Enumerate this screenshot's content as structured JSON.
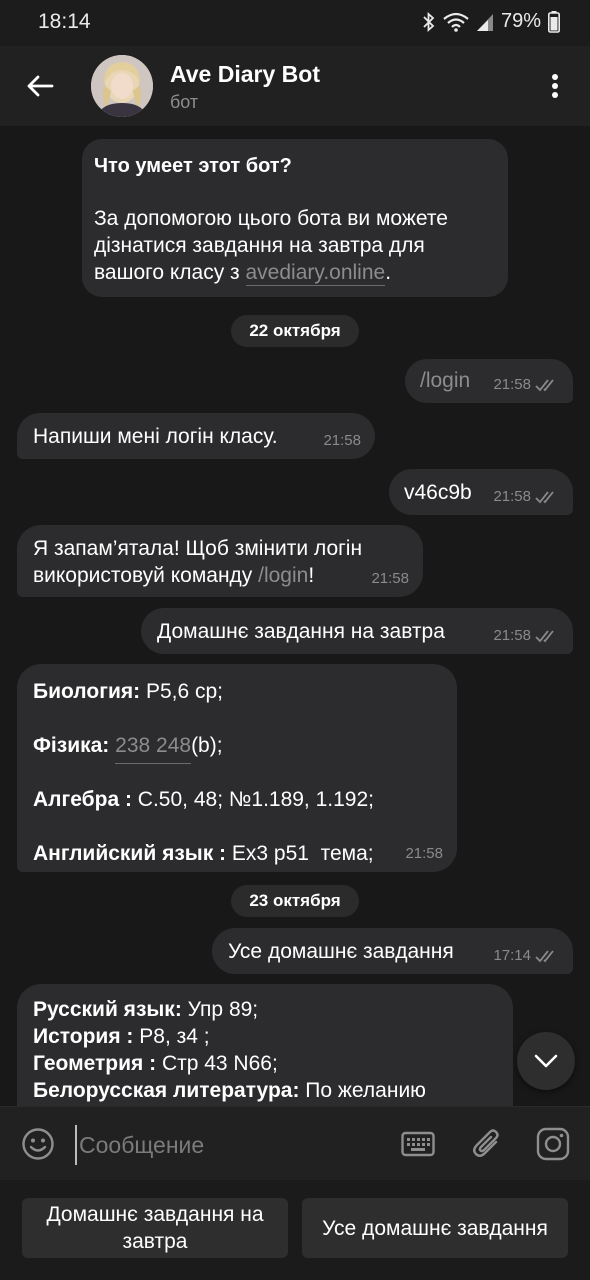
{
  "status_bar": {
    "time": "18:14",
    "battery": "79%",
    "icons": [
      "bluetooth-icon",
      "wifi-icon",
      "signal-icon",
      "battery-icon"
    ]
  },
  "header": {
    "title": "Ave Diary Bot",
    "subtitle": "бот",
    "icons": [
      "back-arrow-icon",
      "more-vertical-icon"
    ]
  },
  "intro_card": {
    "heading": "Что умеет этот бот?",
    "text_before": "За допомогою цього бота ви можете дізнатися завдання на завтра для вашого класу з ",
    "link": "avediary.online",
    "text_after": "."
  },
  "dates": [
    "22 октября",
    "23 октября"
  ],
  "messages": [
    {
      "dir": "out",
      "text": "/login",
      "time": "21:58"
    },
    {
      "dir": "in",
      "text": "Напиши мені логін класу.",
      "time": "21:58"
    },
    {
      "dir": "out",
      "text": "v46c9b",
      "time": "21:58"
    },
    {
      "dir": "in",
      "text_before": "Я запам’ятала! Щоб змінити логін використовуй команду ",
      "command": "/login",
      "text_after": "!",
      "time": "21:58"
    },
    {
      "dir": "out",
      "text": "Домашнє завдання на завтра",
      "time": "21:58"
    },
    {
      "dir": "in",
      "time": "21:58",
      "lines": [
        {
          "label": "Биология:",
          "value": " P5,6 cp;"
        },
        {
          "label": "Фізика:",
          "value_link": "238 248",
          "value": "(b);"
        },
        {
          "label": "Алгебра :",
          "value": " С.50, 48; №1.189, 1.192;"
        },
        {
          "label": "Английский язык :",
          "value": " Ex3 p51  тема;"
        }
      ]
    },
    {
      "dir": "out",
      "text": "Усе домашнє завдання",
      "time": "17:14"
    },
    {
      "dir": "in",
      "lines": [
        {
          "label": "Русский язык:",
          "value": " Упр 89;"
        },
        {
          "label": "История :",
          "value": " P8, з4 ;"
        },
        {
          "label": "Геометрия :",
          "value": " Стр 43 N66;"
        },
        {
          "label": "Белорусская литература:",
          "value": " По желанию"
        }
      ]
    }
  ],
  "input": {
    "placeholder": "Сообщение",
    "icons": [
      "emoji-icon",
      "keyboard-icon",
      "attach-icon",
      "camera-icon"
    ]
  },
  "keyboard_buttons": [
    "Домашнє завдання на завтра",
    "Усе домашнє завдання"
  ],
  "colors": {
    "background": "#181818",
    "bubble": "#2c2c2e",
    "header": "#212121",
    "muted_text": "#8a8a8a"
  }
}
